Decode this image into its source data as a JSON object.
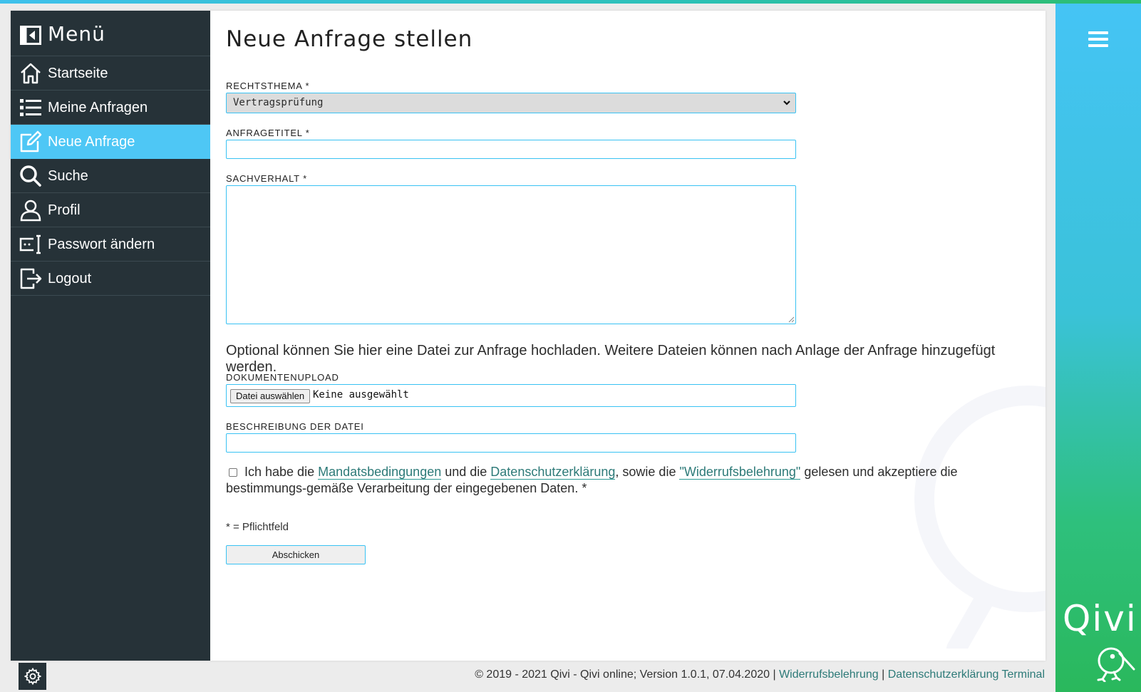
{
  "header": {
    "menu_icon": "hamburger-icon"
  },
  "brand": {
    "name": "Qivi",
    "logo_icon": "kiwi-bird-icon"
  },
  "sidebar": {
    "title": "Menü",
    "collapse_icon": "collapse-left-icon",
    "items": [
      {
        "label": "Startseite",
        "icon": "home-icon",
        "active": false
      },
      {
        "label": "Meine Anfragen",
        "icon": "list-icon",
        "active": false
      },
      {
        "label": "Neue Anfrage",
        "icon": "edit-icon",
        "active": true
      },
      {
        "label": "Suche",
        "icon": "search-icon",
        "active": false
      },
      {
        "label": "Profil",
        "icon": "user-icon",
        "active": false
      },
      {
        "label": "Passwort ändern",
        "icon": "password-icon",
        "active": false
      },
      {
        "label": "Logout",
        "icon": "logout-icon",
        "active": false
      }
    ]
  },
  "form": {
    "title": "Neue Anfrage stellen",
    "rechtsthema": {
      "label": "RECHTSTHEMA *",
      "value": "Vertragsprüfung"
    },
    "anfragetitel": {
      "label": "ANFRAGETITEL *",
      "value": ""
    },
    "sachverhalt": {
      "label": "SACHVERHALT *",
      "value": ""
    },
    "upload_hint": "Optional können Sie hier eine Datei zur Anfrage hochladen. Weitere Dateien können nach Anlage der Anfrage hinzugefügt werden.",
    "dokumentenupload": {
      "label": "DOKUMENTENUPLOAD",
      "button": "Datei auswählen",
      "status": "Keine ausgewählt"
    },
    "beschreibung": {
      "label": "BESCHREIBUNG DER DATEI",
      "value": ""
    },
    "consent": {
      "checked": false,
      "text_1": "Ich habe die ",
      "link_1": "Mandatsbedingungen",
      "text_2": " und die ",
      "link_2": "Datenschutzerklärung",
      "text_3": ", sowie die ",
      "link_3": "\"Widerrufsbelehrung\"",
      "text_4": " gelesen und akzeptiere die bestimmungs-gemäße Verarbeitung der eingegebenen Daten. *"
    },
    "required_note": "* = Pflichtfeld",
    "submit_label": "Abschicken"
  },
  "footer": {
    "settings_icon": "gear-icon",
    "copyright": "© 2019 - 2021 Qivi - Qivi online; Version 1.0.1, 07.04.2020 | ",
    "link_widerruf": "Widerrufsbelehrung",
    "separator": " | ",
    "link_datenschutz": "Datenschutzerklärung",
    "link_terminal": " Terminal"
  },
  "colors": {
    "accent": "#4ec7f5",
    "sidebar_bg": "#263238",
    "link": "#2d7a78",
    "rail_top": "#45c4f5",
    "rail_bottom": "#2ab85c"
  }
}
